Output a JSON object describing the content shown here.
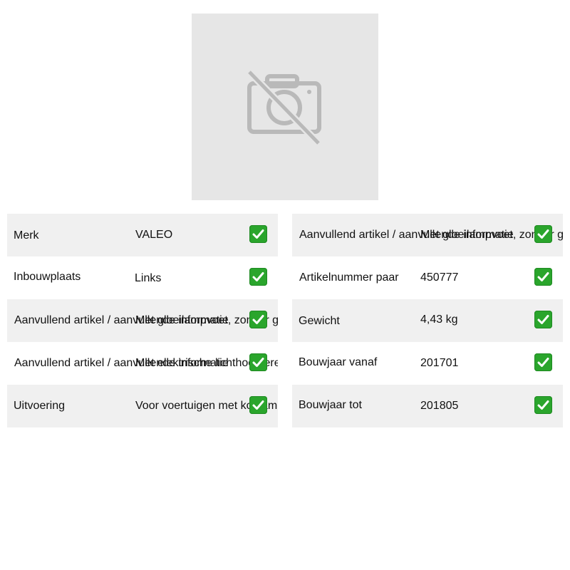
{
  "image": {
    "icon": "no-camera-icon",
    "background_color": "#e6e6e6"
  },
  "left_rows": [
    {
      "label": "Merk",
      "value": "VALEO",
      "icon": "checkmark-icon"
    },
    {
      "label": "Inbouwplaats",
      "value": "Links",
      "icon": "checkmark-icon"
    },
    {
      "label": "Aanvullend artikel / aanvullende informatie",
      "value": "Met gloeilampvoet, zonder gloeilampen, zonder dagrijlicht",
      "icon": "checkmark-icon"
    },
    {
      "label": "Aanvullend artikel / aanvullende informatie",
      "value": "Met elektrische lichthoogteregelmotor, met bochtverlichting",
      "icon": "checkmark-icon"
    },
    {
      "label": "Uitvoering",
      "value": "Voor voertuigen met koplamp links",
      "icon": "checkmark-icon"
    }
  ],
  "right_rows": [
    {
      "label": "Aanvullend artikel / aanvullende informatie",
      "value": "Met gloeilampvoet, zonder gloeilampen, zonder dagrijlicht",
      "icon": "checkmark-icon"
    },
    {
      "label": "Artikelnummer paar",
      "value": "450777",
      "icon": "checkmark-icon"
    },
    {
      "label": "Gewicht",
      "value": "4,43 kg",
      "icon": "checkmark-icon"
    },
    {
      "label": "Bouwjaar vanaf",
      "value": "201701",
      "icon": "checkmark-icon"
    },
    {
      "label": "Bouwjaar tot",
      "value": "201805",
      "icon": "checkmark-icon"
    }
  ],
  "colors": {
    "row_shade": "#f0f0f0",
    "check_green": "#2aa52c"
  }
}
